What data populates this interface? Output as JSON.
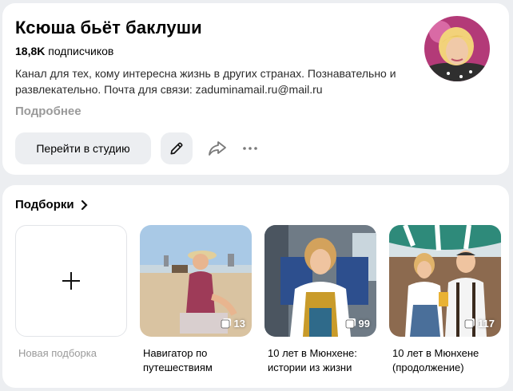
{
  "channel": {
    "name": "Ксюша бьёт баклуши",
    "subscribers_count": "18,8K",
    "subscribers_label": "подписчиков",
    "description": "Канал для тех, кому интересна жизнь в других странах. Познавательно и развлекательно. Почта для связи: zaduminamail.ru@mail.ru",
    "more_label": "Подробнее"
  },
  "actions": {
    "studio_label": "Перейти в студию",
    "edit_icon": "pencil-icon",
    "share_icon": "share-icon",
    "more_icon": "more-dots-icon"
  },
  "collections": {
    "title": "Подборки",
    "new_label": "Новая подборка",
    "items": [
      {
        "title": "Навигатор по путешествиям",
        "count": "13"
      },
      {
        "title": "10 лет в Мюнхене: истории из жизни",
        "count": "99"
      },
      {
        "title": "10 лет в Мюнхене (продолжение)",
        "count": "117"
      }
    ]
  },
  "colors": {
    "page_bg": "#eceef1",
    "card_bg": "#ffffff",
    "muted_text": "#9a9a9a",
    "button_bg": "#eceef1"
  }
}
